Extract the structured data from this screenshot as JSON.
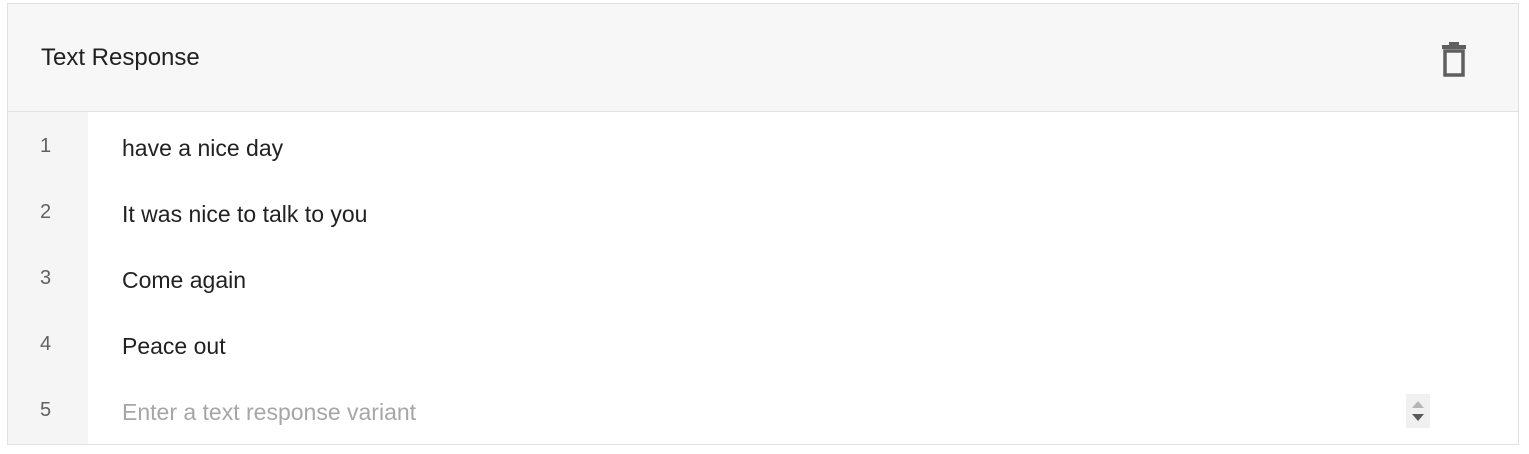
{
  "card": {
    "title": "Text Response",
    "delete_icon": "trash-icon"
  },
  "rows": [
    {
      "number": "1",
      "value": "have a nice day",
      "placeholder": ""
    },
    {
      "number": "2",
      "value": "It was nice to talk to you",
      "placeholder": ""
    },
    {
      "number": "3",
      "value": "Come again",
      "placeholder": ""
    },
    {
      "number": "4",
      "value": "Peace out",
      "placeholder": ""
    },
    {
      "number": "5",
      "value": "",
      "placeholder": "Enter a text response variant"
    }
  ],
  "stepper_icon": "up-down-arrows-icon",
  "colors": {
    "header_bg": "#f7f7f7",
    "gutter_bg": "#f5f5f5",
    "text": "#212121",
    "placeholder": "#a6a6a6",
    "icon": "#616161"
  }
}
